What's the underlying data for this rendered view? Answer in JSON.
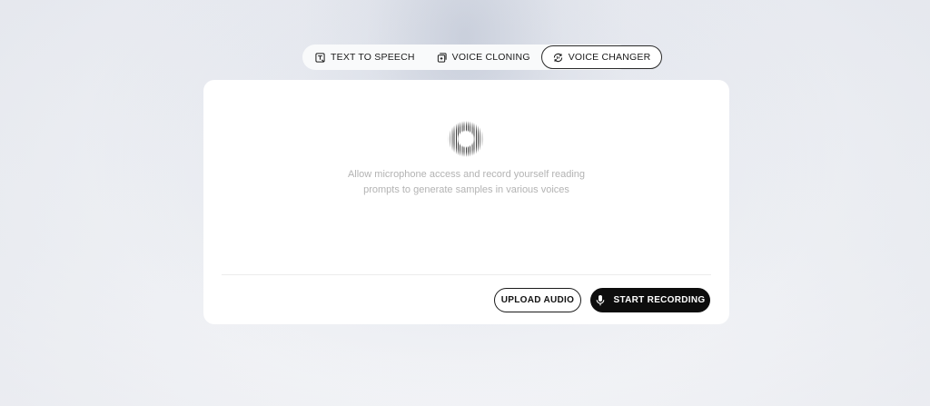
{
  "tabs": [
    {
      "label": "TEXT TO SPEECH",
      "icon": "text-to-speech-icon",
      "active": false
    },
    {
      "label": "VOICE CLONING",
      "icon": "voice-cloning-icon",
      "active": false
    },
    {
      "label": "VOICE CHANGER",
      "icon": "voice-changer-icon",
      "active": true
    }
  ],
  "panel": {
    "description": "Allow microphone access and record yourself reading prompts to generate samples in various voices",
    "orb_icon": "audio-orb-icon",
    "upload_label": "UPLOAD AUDIO",
    "record_label": "START RECORDING",
    "record_icon": "microphone-icon"
  },
  "colors": {
    "accent": "#0d0d0d",
    "muted_text": "#b3b3b3",
    "card": "#ffffff"
  }
}
